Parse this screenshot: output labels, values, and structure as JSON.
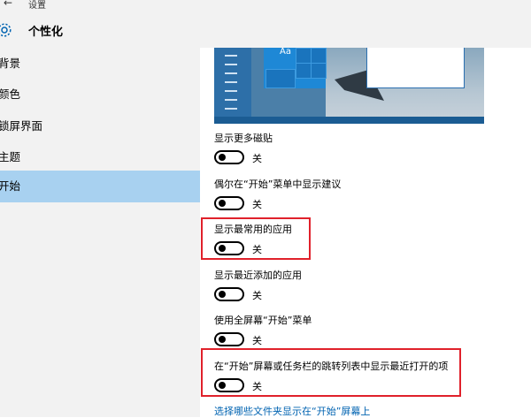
{
  "window": {
    "title": "设置",
    "back_icon": "back-arrow-icon"
  },
  "header": {
    "title": "个性化",
    "icon": "gear-icon"
  },
  "sidebar": {
    "items": [
      {
        "label": "背景",
        "active": false
      },
      {
        "label": "颜色",
        "active": false
      },
      {
        "label": "锁屏界面",
        "active": false
      },
      {
        "label": "主题",
        "active": false
      },
      {
        "label": "开始",
        "active": true
      }
    ]
  },
  "preview": {
    "tile_text": "Aa"
  },
  "settings": [
    {
      "label": "显示更多磁贴",
      "state": "关",
      "on": false,
      "highlighted": false
    },
    {
      "label": "偶尔在“开始”菜单中显示建议",
      "state": "关",
      "on": false,
      "highlighted": false
    },
    {
      "label": "显示最常用的应用",
      "state": "关",
      "on": false,
      "highlighted": true
    },
    {
      "label": "显示最近添加的应用",
      "state": "关",
      "on": false,
      "highlighted": false
    },
    {
      "label": "使用全屏幕“开始”菜单",
      "state": "关",
      "on": false,
      "highlighted": false
    },
    {
      "label": "在“开始”屏幕或任务栏的跳转列表中显示最近打开的项",
      "state": "关",
      "on": false,
      "highlighted": true
    }
  ],
  "link": {
    "label": "选择哪些文件夹显示在“开始”屏幕上"
  },
  "colors": {
    "accent": "#0063b1",
    "highlight": "#e0212b",
    "sidebar_bg": "#f2f2f2",
    "active_bg": "#a8d1f0"
  }
}
